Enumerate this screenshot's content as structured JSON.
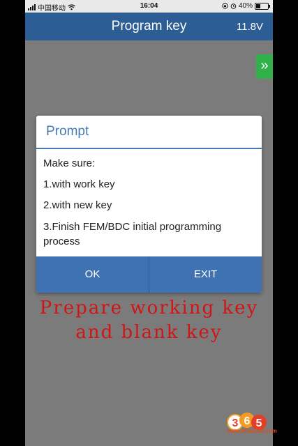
{
  "status_bar": {
    "carrier": "中国移动",
    "time": "16:04",
    "battery_text": "40%",
    "battery_level": 0.4
  },
  "header": {
    "title": "Program key",
    "voltage": "11.8V"
  },
  "side_tab": {
    "glyph": "»"
  },
  "dialog": {
    "title": "Prompt",
    "lines": [
      "Make sure:",
      "1.with work key",
      "2.with new key",
      "3.Finish FEM/BDC initial programming process"
    ],
    "ok_label": "OK",
    "exit_label": "EXIT"
  },
  "overlay_caption": {
    "line1": "Prepare working key",
    "line2": "and blank key"
  },
  "watermark": {
    "text": "www.obdii365.com",
    "logo_digits": [
      "3",
      "6",
      "5"
    ]
  },
  "colors": {
    "header_bg": "#2c5d94",
    "dialog_accent": "#4a7ab3",
    "button_bg": "#3f72b2",
    "side_tab": "#30b14a",
    "caption": "#d21414",
    "backdrop": "#7b7b7b"
  }
}
